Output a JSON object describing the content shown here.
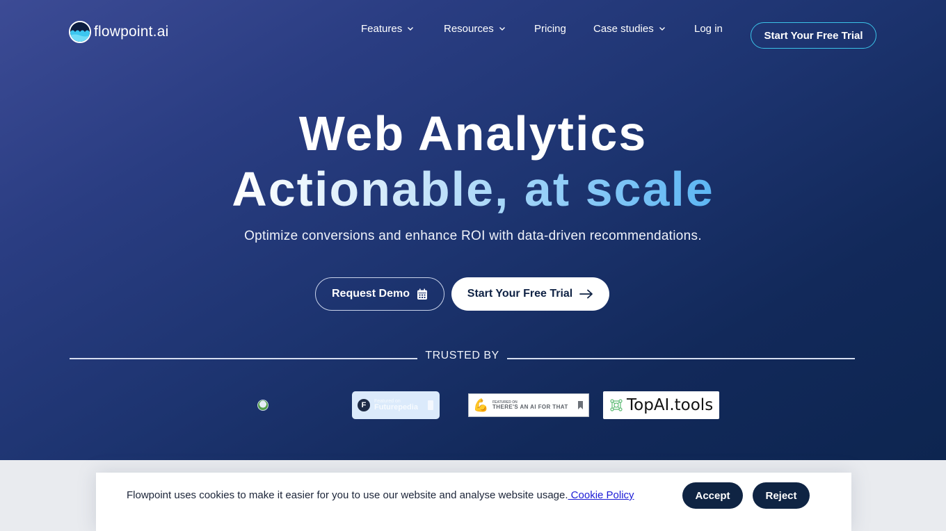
{
  "brand": {
    "name": "flowpoint.ai",
    "logo_icon": "wave-circle-logo-icon"
  },
  "nav": {
    "items": [
      {
        "label": "Features",
        "has_dropdown": true
      },
      {
        "label": "Resources",
        "has_dropdown": true
      },
      {
        "label": "Pricing",
        "has_dropdown": false
      },
      {
        "label": "Case studies",
        "has_dropdown": true
      },
      {
        "label": "Log in",
        "has_dropdown": false
      }
    ],
    "cta_label": "Start Your Free Trial"
  },
  "hero": {
    "title_line1": "Web Analytics",
    "title_line2": "Actionable, at scale",
    "subtitle": "Optimize conversions and enhance ROI with data-driven recommendations.",
    "demo_button": {
      "label": "Request Demo",
      "icon": "calendar-icon"
    },
    "trial_button": {
      "label": "Start Your Free Trial",
      "icon": "arrow-right-icon"
    }
  },
  "trusted": {
    "label": "TRUSTED BY",
    "badges": [
      {
        "name": "broken-image"
      },
      {
        "name": "Futurepedia",
        "small": "Featured on",
        "big": "Futurepedia"
      },
      {
        "name": "There's An AI For That",
        "small": "FEATURED ON",
        "big": "THERE'S AN AI FOR THAT"
      },
      {
        "name": "TopAI.tools",
        "text": "TopAI.tools"
      }
    ]
  },
  "cookie": {
    "text": "Flowpoint uses cookies to make it easier for you to use our website and analyse website usage.",
    "link": " Cookie Policy",
    "accept": "Accept",
    "reject": "Reject"
  },
  "colors": {
    "hero_top": "#3c4b95",
    "hero_bottom": "#0d2550",
    "nav_cta_border": "#3bc3e8",
    "cookie_button": "#0f2443",
    "link": "#1a1ad6",
    "headline_accent": "#5cb6f4"
  }
}
